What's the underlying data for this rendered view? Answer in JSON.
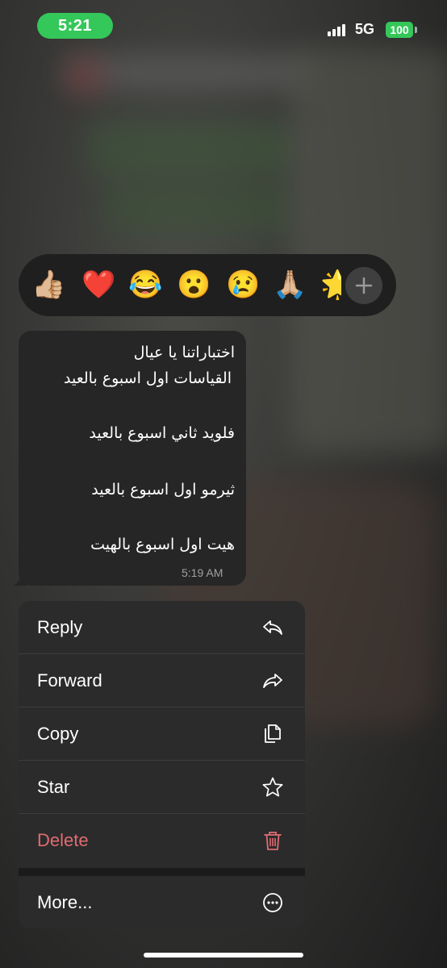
{
  "status_bar": {
    "time": "5:21",
    "network": "5G",
    "battery": "100",
    "accent_color": "#34c759"
  },
  "reactions": {
    "emojis": [
      "👍🏼",
      "❤️",
      "😂",
      "😮",
      "😢",
      "🙏🏼",
      "🌟"
    ],
    "more_icon": "plus-icon"
  },
  "message": {
    "lines": [
      "اختباراتنا يا عيال",
      "القياسات اول اسبوع بالعيد",
      "فلويد ثاني اسبوع بالعيد",
      "ثيرمو اول اسبوع بالعيد",
      "هيت اول اسبوع بالهيت"
    ],
    "time": "5:19 AM"
  },
  "menu": {
    "items": [
      {
        "label": "Reply",
        "icon": "reply-icon"
      },
      {
        "label": "Forward",
        "icon": "forward-icon"
      },
      {
        "label": "Copy",
        "icon": "copy-icon"
      },
      {
        "label": "Star",
        "icon": "star-icon"
      },
      {
        "label": "Delete",
        "icon": "trash-icon",
        "color": "#e06c73"
      },
      {
        "label": "More...",
        "icon": "more-icon"
      }
    ]
  }
}
